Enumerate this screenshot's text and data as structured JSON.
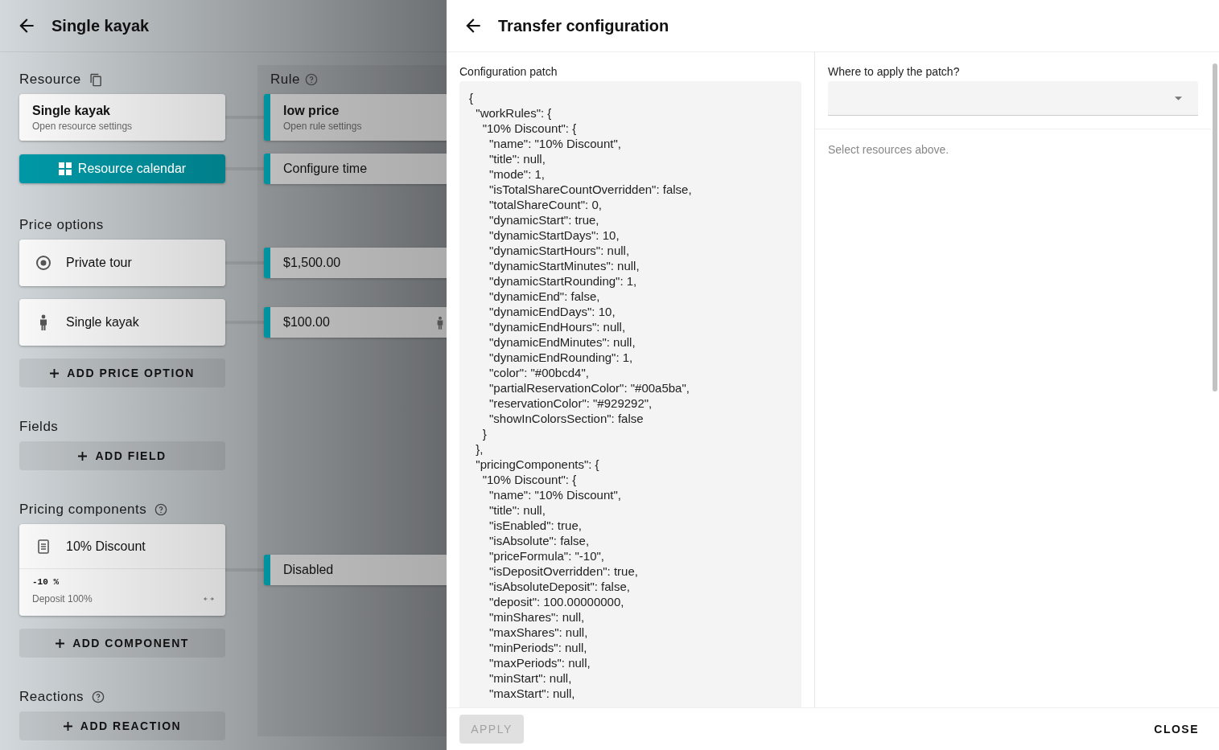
{
  "background_page": {
    "header": {
      "title": "Single kayak"
    },
    "resource": {
      "heading": "Resource",
      "card": {
        "title": "Single kayak",
        "subtitle": "Open resource settings"
      },
      "calendar_button": "Resource calendar"
    },
    "rule": {
      "heading": "Rule",
      "card": {
        "title": "low price",
        "subtitle": "Open rule settings"
      },
      "time_button": "Configure time"
    },
    "price_options": {
      "heading": "Price options",
      "items": [
        {
          "kind": "private",
          "label": "Private tour",
          "price": "$1,500.00"
        },
        {
          "kind": "person",
          "label": "Single kayak",
          "price": "$100.00"
        }
      ],
      "add_button": "ADD PRICE OPTION"
    },
    "fields": {
      "heading": "Fields",
      "add_button": "ADD FIELD"
    },
    "pricing_components": {
      "heading": "Pricing components",
      "items": [
        {
          "label": "10% Discount",
          "formula": "-10 %",
          "deposit": "Deposit 100%",
          "rule_value": "Disabled"
        }
      ],
      "add_button": "ADD COMPONENT"
    },
    "reactions": {
      "heading": "Reactions",
      "add_button": "ADD REACTION"
    }
  },
  "drawer": {
    "title": "Transfer configuration",
    "patch_label": "Configuration patch",
    "patch_lines": [
      "{",
      "  \"workRules\": {",
      "    \"10% Discount\": {",
      "      \"name\": \"10% Discount\",",
      "      \"title\": null,",
      "      \"mode\": 1,",
      "      \"isTotalShareCountOverridden\": false,",
      "      \"totalShareCount\": 0,",
      "      \"dynamicStart\": true,",
      "      \"dynamicStartDays\": 10,",
      "      \"dynamicStartHours\": null,",
      "      \"dynamicStartMinutes\": null,",
      "      \"dynamicStartRounding\": 1,",
      "      \"dynamicEnd\": false,",
      "      \"dynamicEndDays\": 10,",
      "      \"dynamicEndHours\": null,",
      "      \"dynamicEndMinutes\": null,",
      "      \"dynamicEndRounding\": 1,",
      "      \"color\": \"#00bcd4\",",
      "      \"partialReservationColor\": \"#00a5ba\",",
      "      \"reservationColor\": \"#929292\",",
      "      \"showInColorsSection\": false",
      "    }",
      "  },",
      "  \"pricingComponents\": {",
      "    \"10% Discount\": {",
      "      \"name\": \"10% Discount\",",
      "      \"title\": null,",
      "      \"isEnabled\": true,",
      "      \"isAbsolute\": false,",
      "      \"priceFormula\": \"-10\",",
      "      \"isDepositOverridden\": true,",
      "      \"isAbsoluteDeposit\": false,",
      "      \"deposit\": 100.00000000,",
      "      \"minShares\": null,",
      "      \"maxShares\": null,",
      "      \"minPeriods\": null,",
      "      \"maxPeriods\": null,",
      "      \"minStart\": null,",
      "      \"maxStart\": null,"
    ],
    "target_label": "Where to apply the patch?",
    "target_hint": "Select resources above.",
    "apply_button": {
      "label": "APPLY",
      "disabled": true
    },
    "close_button": "CLOSE"
  }
}
